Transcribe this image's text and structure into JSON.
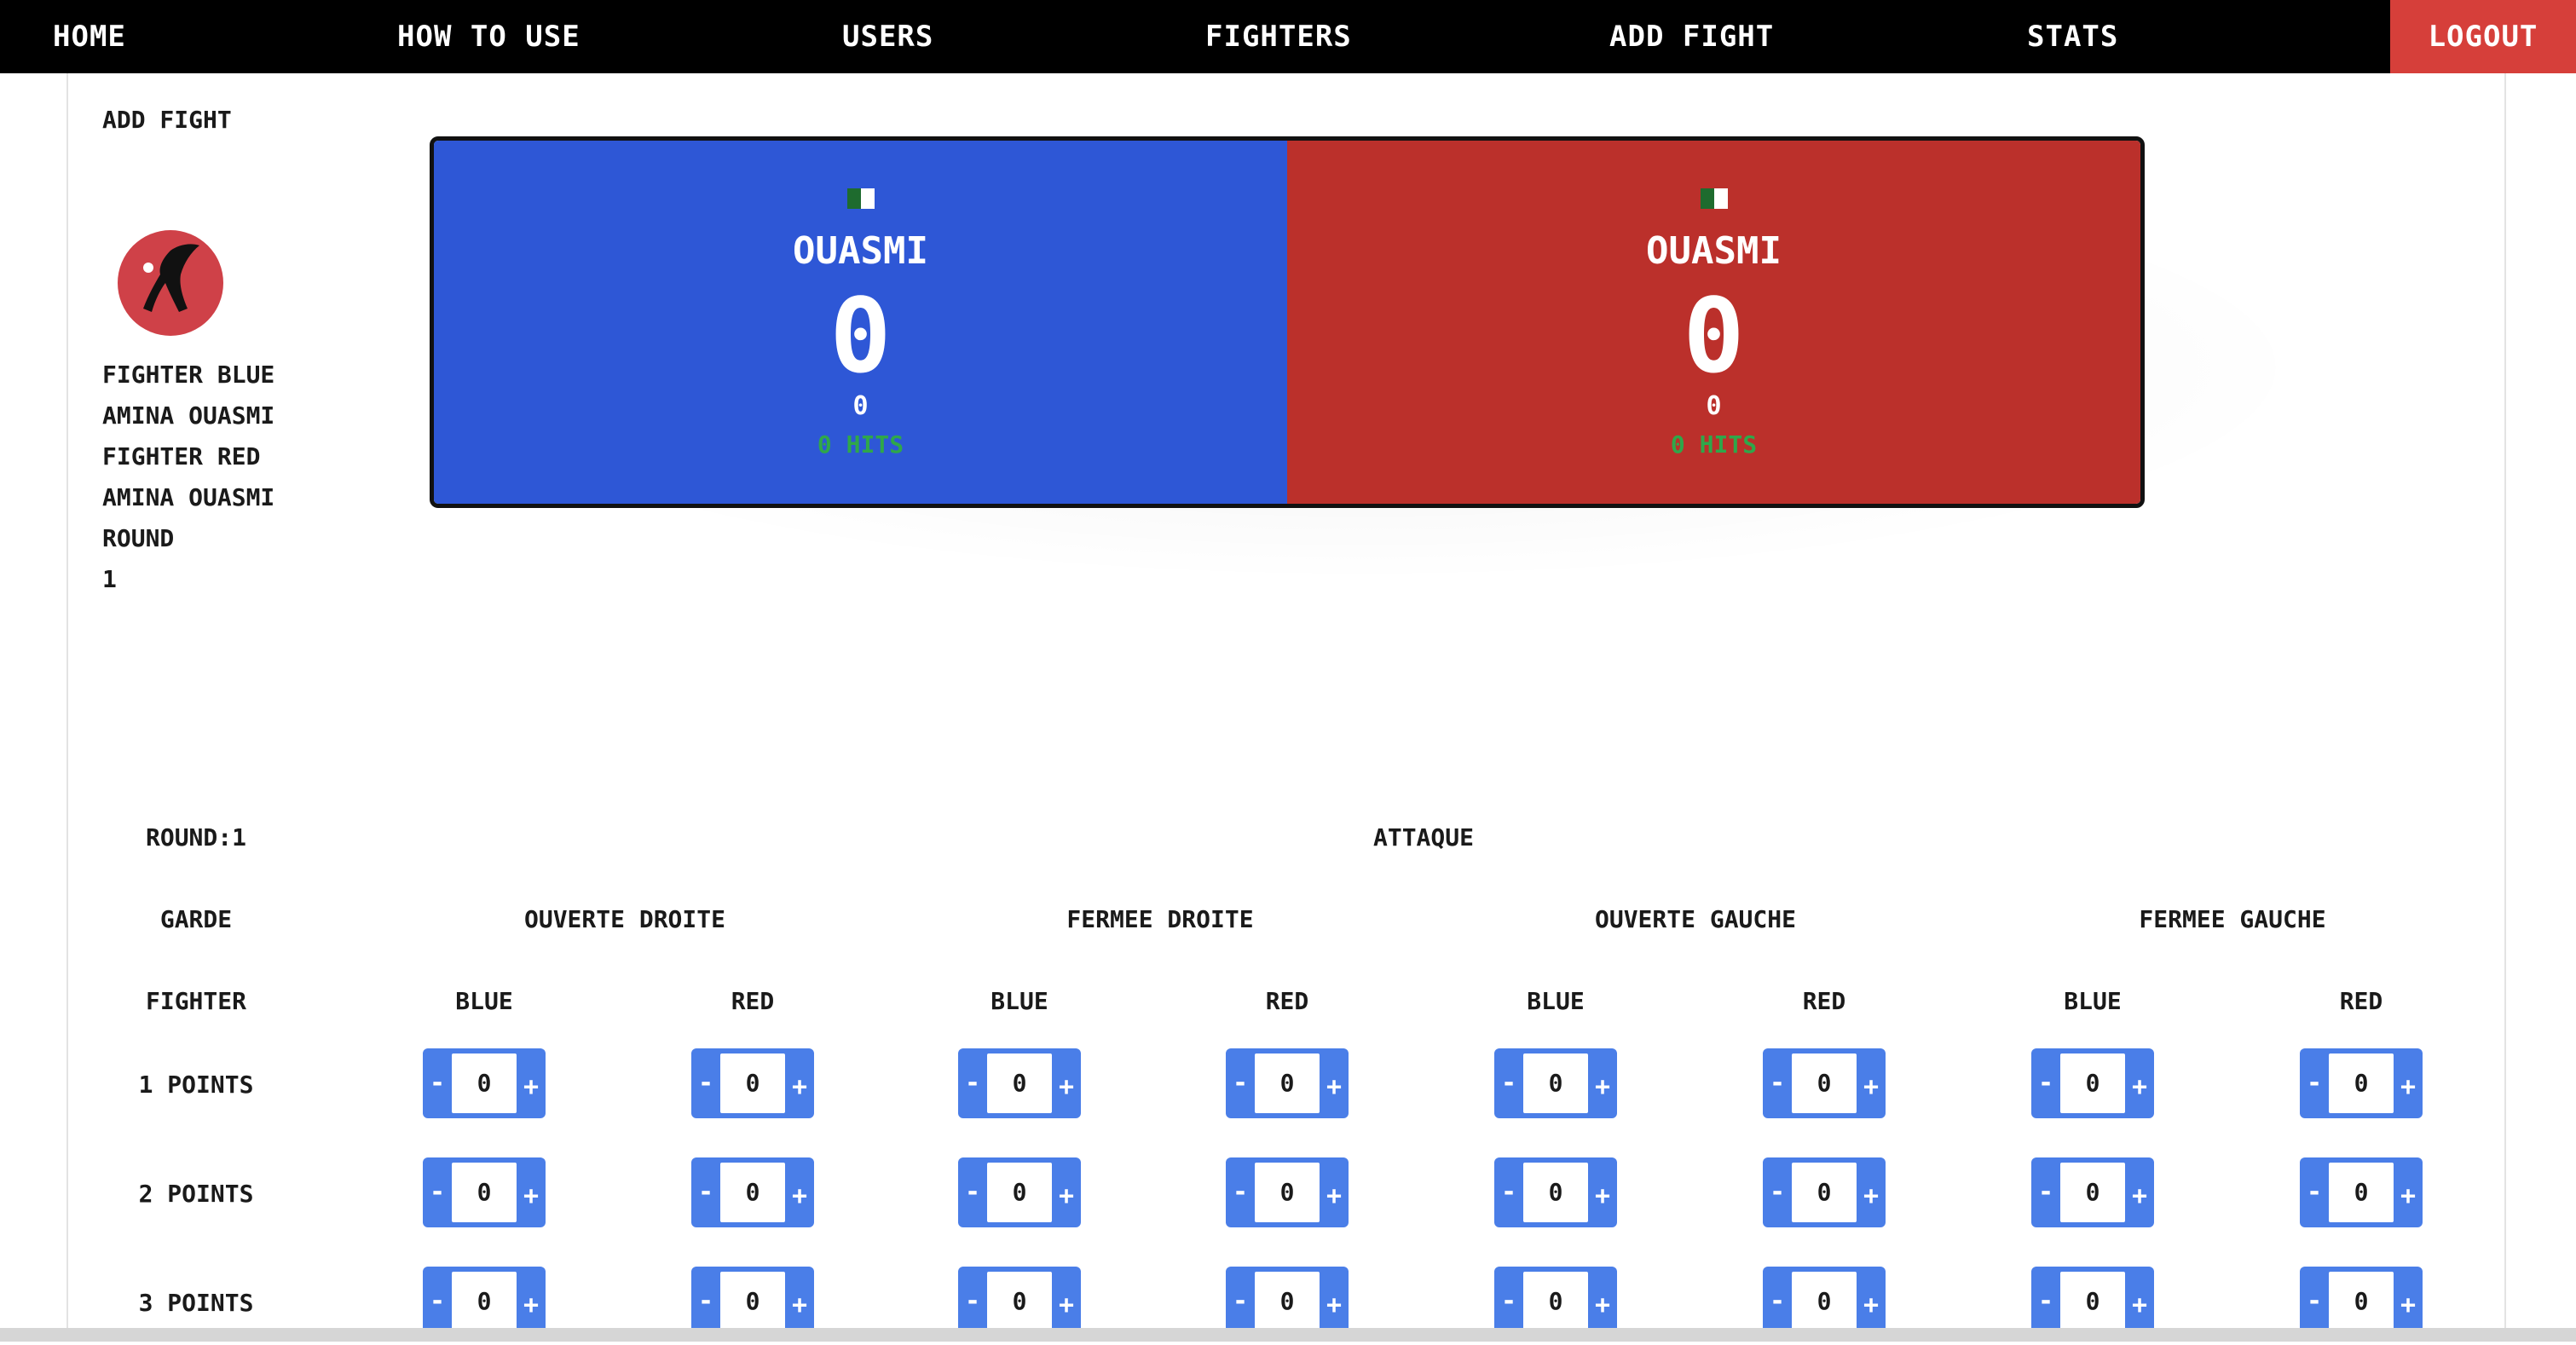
{
  "nav": {
    "home": "HOME",
    "how_to_use": "HOW TO USE",
    "users": "USERS",
    "fighters": "FIGHTERS",
    "add_fight": "ADD FIGHT",
    "stats": "STATS",
    "logout": "LOGOUT"
  },
  "colors": {
    "nav_bg": "#000000",
    "logout_bg": "#d63f3a",
    "blue_panel": "#2e57d6",
    "red_panel": "#bb302b",
    "hits_text": "#2fa74a",
    "stepper": "#4a7ee8"
  },
  "sidebar": {
    "title": "ADD FIGHT",
    "logo_icon": "karate-kick-logo",
    "fighter_blue_label": "FIGHTER BLUE",
    "fighter_blue_name": "AMINA OUASMI",
    "fighter_red_label": "FIGHTER RED",
    "fighter_red_name": "AMINA OUASMI",
    "round_label": "ROUND",
    "round_value": "1"
  },
  "scoreboard": {
    "blue": {
      "flag_icon": "algeria-flag-icon",
      "name": "OUASMI",
      "score": "0",
      "sub_score": "0",
      "hits": "0 HITS"
    },
    "red": {
      "flag_icon": "algeria-flag-icon",
      "name": "OUASMI",
      "score": "0",
      "sub_score": "0",
      "hits": "0 HITS"
    }
  },
  "table": {
    "round_label": "ROUND:1",
    "attack_header": "ATTAQUE",
    "garde_label": "GARDE",
    "fighter_label": "FIGHTER",
    "gardes": [
      "OUVERTE DROITE",
      "FERMEE DROITE",
      "OUVERTE GAUCHE",
      "FERMEE GAUCHE"
    ],
    "fighters": [
      "BLUE",
      "RED",
      "BLUE",
      "RED",
      "BLUE",
      "RED",
      "BLUE",
      "RED"
    ],
    "rows": [
      {
        "label": "1 POINTS",
        "values": [
          "0",
          "0",
          "0",
          "0",
          "0",
          "0",
          "0",
          "0"
        ]
      },
      {
        "label": "2 POINTS",
        "values": [
          "0",
          "0",
          "0",
          "0",
          "0",
          "0",
          "0",
          "0"
        ]
      },
      {
        "label": "3 POINTS",
        "values": [
          "0",
          "0",
          "0",
          "0",
          "0",
          "0",
          "0",
          "0"
        ]
      }
    ],
    "minus_label": "-",
    "plus_label": "+"
  }
}
